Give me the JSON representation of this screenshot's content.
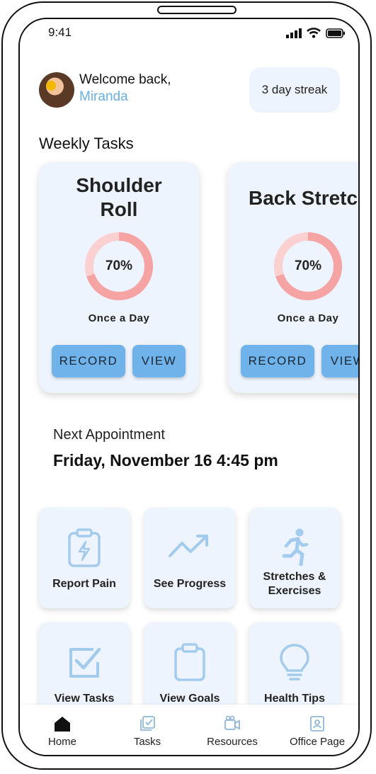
{
  "status_bar": {
    "time": "9:41"
  },
  "header": {
    "greeting": "Welcome back,",
    "user_name": "Miranda",
    "streak": "3 day streak"
  },
  "weekly_tasks": {
    "title": "Weekly Tasks",
    "cards": [
      {
        "title_line1": "Shoulder",
        "title_line2": "Roll",
        "progress": "70%",
        "progress_fraction": 0.7,
        "frequency": "Once a Day",
        "record_label": "RECORD",
        "view_label": "VIEW"
      },
      {
        "title_line1": "Back Stretch",
        "progress": "70%",
        "progress_fraction": 0.7,
        "frequency": "Once a Day",
        "record_label": "RECORD",
        "view_label": "VIEW"
      }
    ]
  },
  "appointment": {
    "label": "Next Appointment",
    "date": "Friday, November 16 4:45 pm"
  },
  "tiles": [
    {
      "label_line1": "Report Pain",
      "label_line2": "",
      "icon": "clipboard-pain-icon"
    },
    {
      "label_line1": "See Progress",
      "label_line2": "",
      "icon": "trending-up-icon"
    },
    {
      "label_line1": "Stretches &",
      "label_line2": "Exercises",
      "icon": "running-person-icon"
    },
    {
      "label_line1": "View Tasks",
      "label_line2": "",
      "icon": "checkbox-icon"
    },
    {
      "label_line1": "View Goals",
      "label_line2": "",
      "icon": "clipboard-icon"
    },
    {
      "label_line1": "Health Tips",
      "label_line2": "",
      "icon": "lightbulb-icon"
    }
  ],
  "tab_bar": {
    "items": [
      {
        "label": "Home",
        "icon": "home-icon",
        "active": true
      },
      {
        "label": "Tasks",
        "icon": "tasks-icon",
        "active": false
      },
      {
        "label": "Resources",
        "icon": "video-icon",
        "active": false
      },
      {
        "label": "Office Page",
        "icon": "profile-badge-icon",
        "active": false
      }
    ]
  },
  "colors": {
    "accent_blue": "#6fb3ea",
    "name_blue": "#67b0e6",
    "card_bg": "#eef4fd",
    "ring_pink": "#f5a3a3",
    "ring_track": "#fbd0d0",
    "icon_blue": "#a3cbed"
  }
}
